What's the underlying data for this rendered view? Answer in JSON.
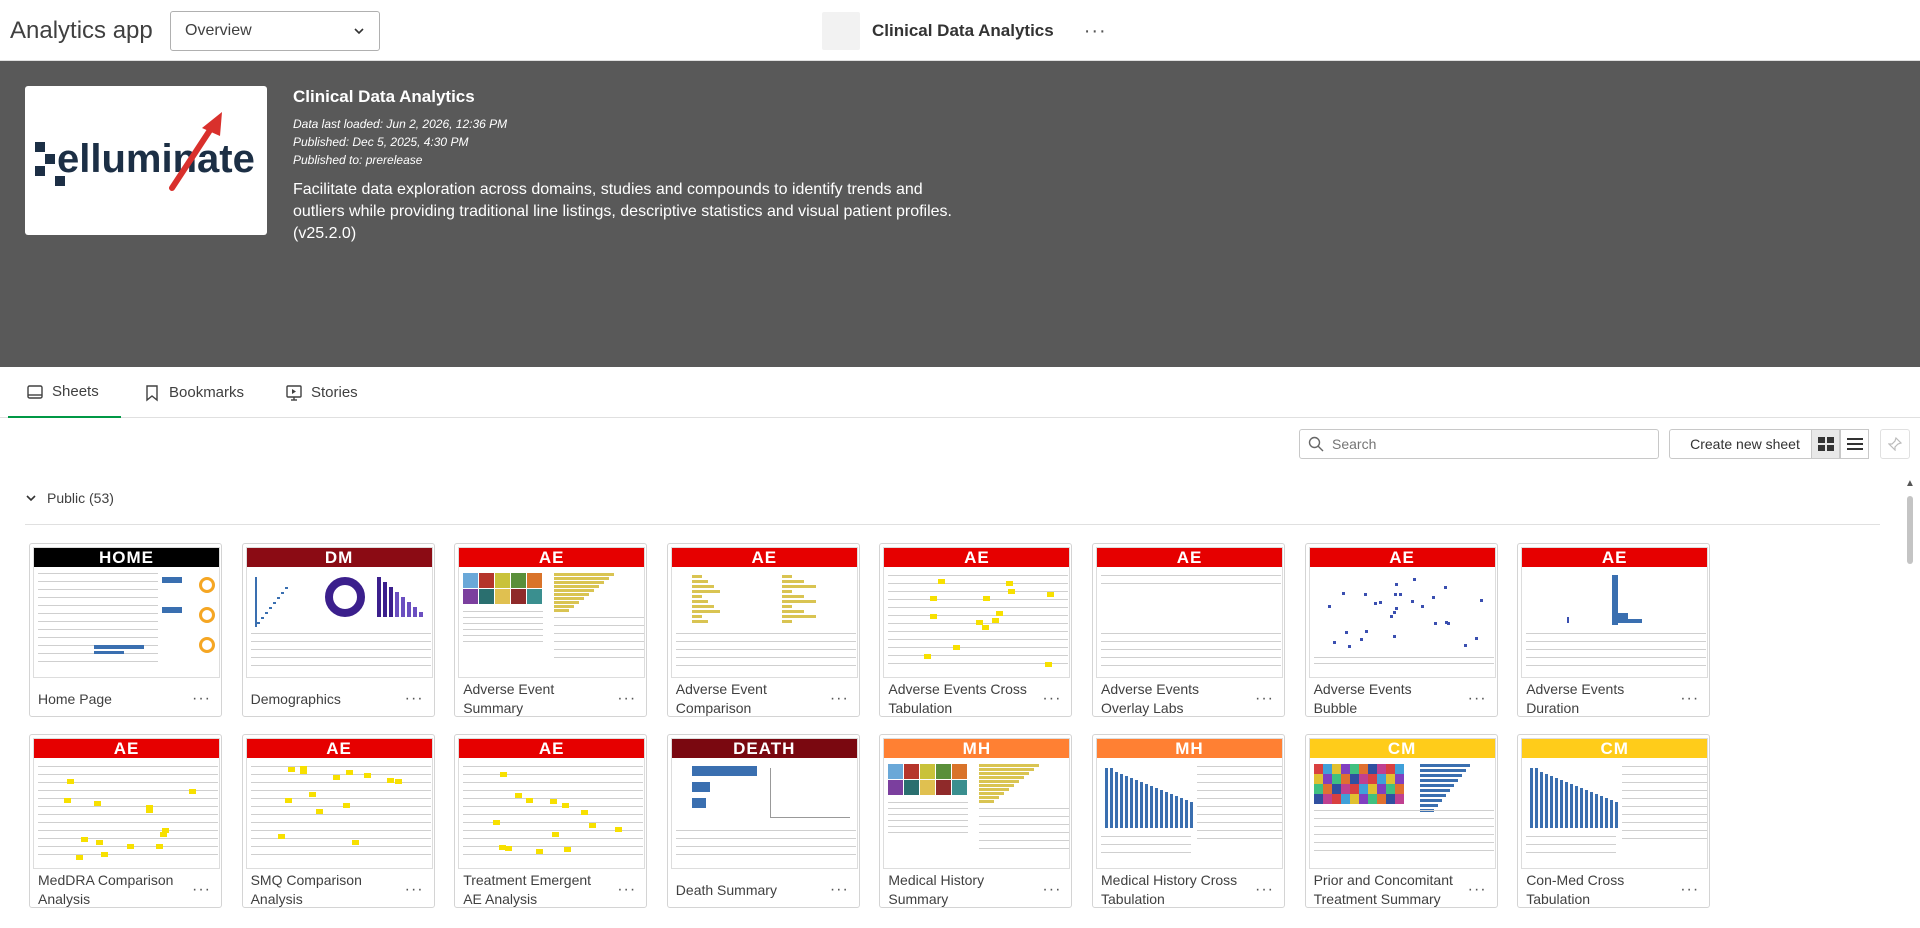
{
  "topbar": {
    "app_title": "Analytics app",
    "nav_selected": "Overview",
    "center_title": "Clinical Data Analytics",
    "more_label": "···"
  },
  "hero": {
    "logo_text": "elluminate",
    "title": "Clinical Data Analytics",
    "data_loaded": "Data last loaded: Jun 2, 2026, 12:36 PM",
    "published": "Published: Dec 5, 2025, 4:30 PM",
    "published_to": "Published to: prerelease",
    "description": "Facilitate data exploration across domains, studies and compounds to identify trends and outliers while providing traditional line listings, descriptive statistics and visual patient profiles. (v25.2.0)"
  },
  "tabs": [
    {
      "label": "Sheets",
      "icon": "sheet-icon",
      "active": true
    },
    {
      "label": "Bookmarks",
      "icon": "bookmark-icon",
      "active": false
    },
    {
      "label": "Stories",
      "icon": "story-icon",
      "active": false
    }
  ],
  "toolbar": {
    "search_placeholder": "Search",
    "create_label": "Create new sheet"
  },
  "section": {
    "label": "Public (53)"
  },
  "colors": {
    "home": "#000000",
    "dm": "#8b0b14",
    "ae": "#e60000",
    "death": "#7a0810",
    "mh": "#ff8033",
    "cm": "#ffcc1a",
    "accent": "#009845",
    "hero_bg": "#595959"
  },
  "cards": [
    {
      "tag": "HOME",
      "color_key": "home",
      "label": "Home Page",
      "preview": "home"
    },
    {
      "tag": "DM",
      "color_key": "dm",
      "label": "Demographics",
      "preview": "dm"
    },
    {
      "tag": "AE",
      "color_key": "ae",
      "label": "Adverse Event Summary",
      "preview": "treemap"
    },
    {
      "tag": "AE",
      "color_key": "ae",
      "label": "Adverse Event Comparison",
      "preview": "bars"
    },
    {
      "tag": "AE",
      "color_key": "ae",
      "label": "Adverse Events Cross Tabulation",
      "preview": "table"
    },
    {
      "tag": "AE",
      "color_key": "ae",
      "label": "Adverse Events Overlay Labs",
      "preview": "blank"
    },
    {
      "tag": "AE",
      "color_key": "ae",
      "label": "Adverse Events Bubble",
      "preview": "scatter"
    },
    {
      "tag": "AE",
      "color_key": "ae",
      "label": "Adverse Events Duration",
      "preview": "duration"
    },
    {
      "tag": "AE",
      "color_key": "ae",
      "label": "MedDRA Comparison Analysis",
      "preview": "table"
    },
    {
      "tag": "AE",
      "color_key": "ae",
      "label": "SMQ Comparison Analysis",
      "preview": "table"
    },
    {
      "tag": "AE",
      "color_key": "ae",
      "label": "Treatment Emergent AE Analysis",
      "preview": "table"
    },
    {
      "tag": "DEATH",
      "color_key": "death",
      "label": "Death Summary",
      "preview": "death"
    },
    {
      "tag": "MH",
      "color_key": "mh",
      "label": "Medical History Summary",
      "preview": "treemap"
    },
    {
      "tag": "MH",
      "color_key": "mh",
      "label": "Medical History Cross Tabulation",
      "preview": "histo"
    },
    {
      "tag": "CM",
      "color_key": "cm",
      "label": "Prior and Concomitant Treatment Summary",
      "preview": "colorful"
    },
    {
      "tag": "CM",
      "color_key": "cm",
      "label": "Con-Med Cross Tabulation",
      "preview": "histo"
    }
  ]
}
